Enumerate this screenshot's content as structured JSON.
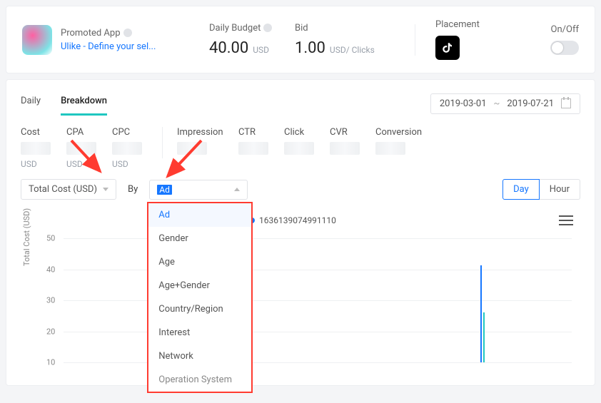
{
  "header": {
    "promoted_label": "Promoted App",
    "app_link": "Ulike - Define your sel...",
    "daily_budget_label": "Daily Budget",
    "daily_budget_value": "40.00",
    "daily_budget_unit": "USD",
    "bid_label": "Bid",
    "bid_value": "1.00",
    "bid_unit": "USD/ Clicks",
    "placement_label": "Placement",
    "onoff_label": "On/Off"
  },
  "tabs": {
    "daily": "Daily",
    "breakdown": "Breakdown"
  },
  "date": {
    "from": "2019-03-01",
    "sep": "~",
    "to": "2019-07-21"
  },
  "metrics": {
    "cost": "Cost",
    "cpa": "CPA",
    "cpc": "CPC",
    "impression": "Impression",
    "ctr": "CTR",
    "click": "Click",
    "cvr": "CVR",
    "conversion": "Conversion",
    "usd": "USD"
  },
  "controls": {
    "total_cost": "Total Cost (USD)",
    "by": "By",
    "selected_breakdown_short": "Ad",
    "day": "Day",
    "hour": "Hour"
  },
  "breakdown_options": [
    "Ad",
    "Gender",
    "Age",
    "Age+Gender",
    "Country/Region",
    "Interest",
    "Network",
    "Operation System"
  ],
  "chart": {
    "legend_series": "1636139074991110",
    "ylabel": "Total Cost (USD)",
    "yticks": [
      "50",
      "40",
      "30",
      "20",
      "10"
    ]
  },
  "chart_data": {
    "type": "line",
    "title": "",
    "xlabel": "",
    "ylabel": "Total Cost (USD)",
    "ylim": [
      0,
      50
    ],
    "x_range": [
      "2019-03-01",
      "2019-07-21"
    ],
    "series": [
      {
        "name": "1636139074991110",
        "note": "single spike near 2019-06-25",
        "peak_value": 40
      }
    ]
  }
}
